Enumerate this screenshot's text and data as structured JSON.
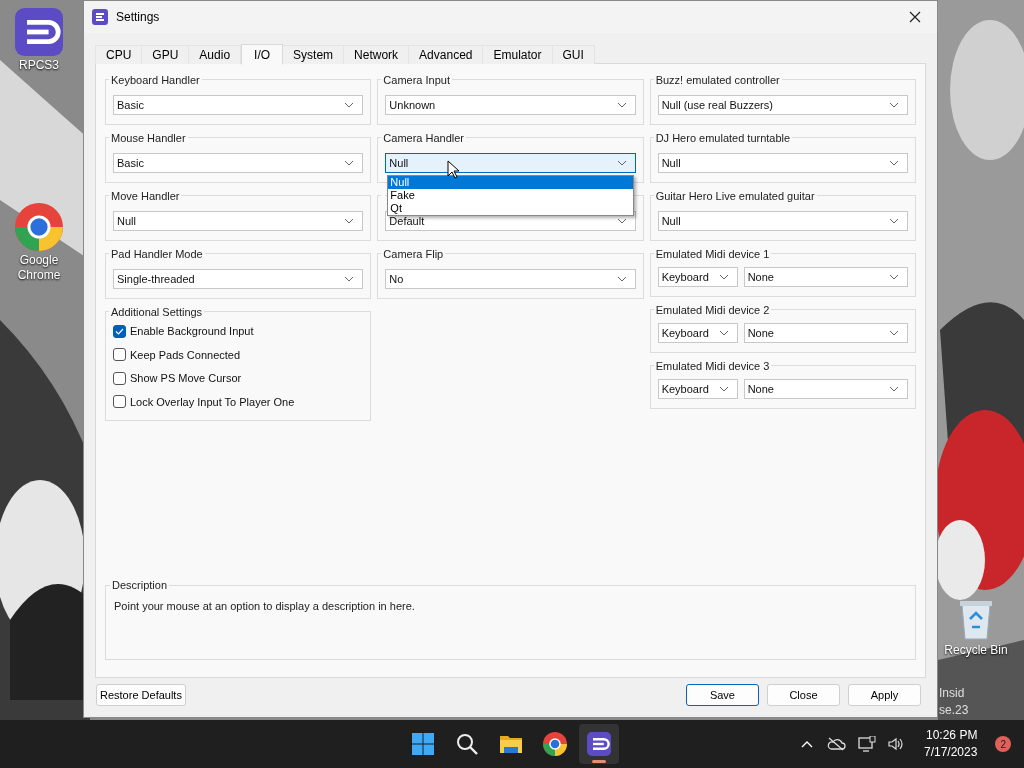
{
  "desktop_icons": [
    {
      "kind": "rpcs3",
      "label": "RPCS3"
    },
    {
      "kind": "chrome",
      "label": "Google Chrome"
    },
    {
      "kind": "bin",
      "label": "Recycle Bin"
    }
  ],
  "desktop_watermark": [
    "Insid",
    "se.23"
  ],
  "window": {
    "title": "Settings"
  },
  "tabs": [
    {
      "label": "CPU",
      "selected": false
    },
    {
      "label": "GPU",
      "selected": false
    },
    {
      "label": "Audio",
      "selected": false
    },
    {
      "label": "I/O",
      "selected": true
    },
    {
      "label": "System",
      "selected": false
    },
    {
      "label": "Network",
      "selected": false
    },
    {
      "label": "Advanced",
      "selected": false
    },
    {
      "label": "Emulator",
      "selected": false
    },
    {
      "label": "GUI",
      "selected": false
    }
  ],
  "columns": [
    [
      {
        "kind": "combo",
        "label": "Keyboard Handler",
        "value": "Basic"
      },
      {
        "kind": "combo",
        "label": "Mouse Handler",
        "value": "Basic"
      },
      {
        "kind": "combo",
        "label": "Move Handler",
        "value": "Null"
      },
      {
        "kind": "combo",
        "label": "Pad Handler Mode",
        "value": "Single-threaded"
      },
      {
        "kind": "checks",
        "label": "Additional Settings",
        "items": [
          {
            "label": "Enable Background Input",
            "checked": true
          },
          {
            "label": "Keep Pads Connected",
            "checked": false
          },
          {
            "label": "Show PS Move Cursor",
            "checked": false
          },
          {
            "label": "Lock Overlay Input To Player One",
            "checked": false
          }
        ]
      }
    ],
    [
      {
        "kind": "combo",
        "label": "Camera Input",
        "value": "Unknown"
      },
      {
        "kind": "combo",
        "label": "Camera Handler",
        "value": "Null",
        "focused": true,
        "open_list": [
          {
            "label": "Null",
            "selected": true
          },
          {
            "label": "Fake",
            "selected": false
          },
          {
            "label": "Qt",
            "selected": false
          }
        ]
      },
      {
        "kind": "combo",
        "value": "Default"
      },
      {
        "kind": "combo",
        "label": "Camera Flip",
        "value": "No"
      }
    ],
    [
      {
        "kind": "combo",
        "label": "Buzz! emulated controller",
        "value": "Null (use real Buzzers)"
      },
      {
        "kind": "combo",
        "label": "DJ Hero emulated turntable",
        "value": "Null"
      },
      {
        "kind": "combo",
        "label": "Guitar Hero Live emulated guitar",
        "value": "Null"
      },
      {
        "kind": "pair",
        "label": "Emulated Midi device 1",
        "values": [
          "Keyboard",
          "None"
        ]
      },
      {
        "kind": "pair",
        "label": "Emulated Midi device 2",
        "values": [
          "Keyboard",
          "None"
        ]
      },
      {
        "kind": "pair",
        "label": "Emulated Midi device 3",
        "values": [
          "Keyboard",
          "None"
        ]
      }
    ]
  ],
  "description": {
    "label": "Description",
    "text": "Point your mouse at an option to display a description in here."
  },
  "footer_buttons": [
    {
      "label": "Restore Defaults",
      "default": false
    },
    {
      "label": "Save",
      "default": true
    },
    {
      "label": "Close",
      "default": false
    },
    {
      "label": "Apply",
      "default": false
    }
  ],
  "taskbar": {
    "apps": [
      {
        "kind": "start",
        "selected": false
      },
      {
        "kind": "search",
        "selected": false
      },
      {
        "kind": "folder",
        "selected": false
      },
      {
        "kind": "chrome",
        "selected": false
      },
      {
        "kind": "rpcs3",
        "selected": true
      }
    ],
    "time": "10:26 PM",
    "date": "7/17/2023",
    "notifications": "2"
  }
}
